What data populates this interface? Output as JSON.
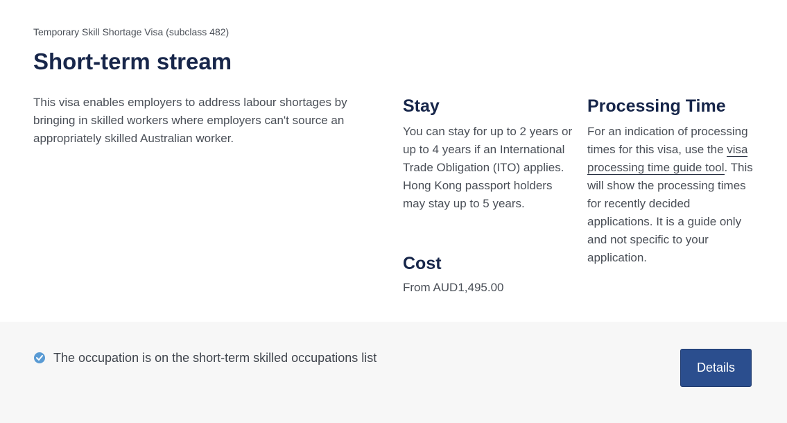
{
  "header": {
    "subtitle": "Temporary Skill Shortage Visa (subclass 482)",
    "title": "Short-term stream"
  },
  "intro": "This visa enables employers to address labour shortages by bringing in skilled workers where employers can't source an appropriately skilled Australian worker.",
  "stay": {
    "heading": "Stay",
    "text": "You can stay for up to 2 years or up to 4 years if an International Trade Obligation (ITO) applies. Hong Kong passport holders may stay up to 5 years."
  },
  "cost": {
    "heading": "Cost",
    "text": "From AUD1,495.00"
  },
  "processing": {
    "heading": "Processing Time",
    "text_before": "For an indication of processing times for this visa, use the ",
    "link": "visa processing time guide tool",
    "text_after": ". This will show the processing times for recently decided applications. It is a guide only and not specific to your application."
  },
  "footer": {
    "status_text": "The occupation is on the short-term skilled occupations list",
    "status_icon": "check-circle-icon",
    "details_label": "Details"
  },
  "colors": {
    "accent": "#2b4e8e",
    "check": "#5a9bd4",
    "title": "#17264a"
  }
}
